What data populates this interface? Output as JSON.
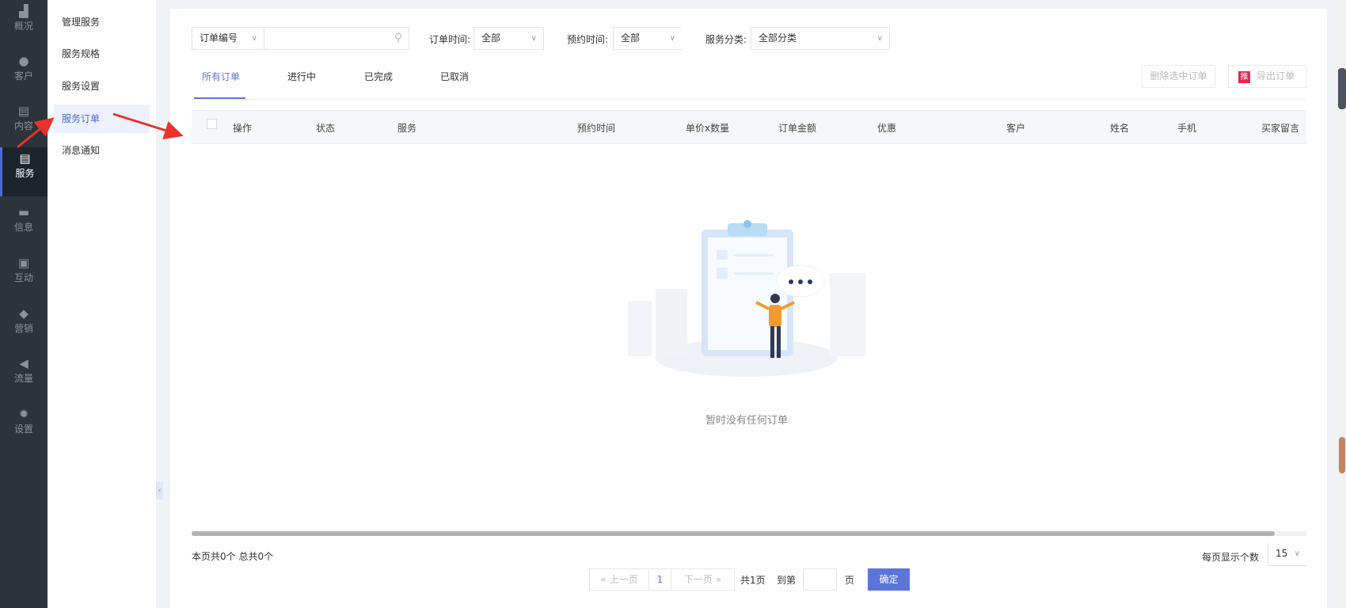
{
  "sidebar": {
    "items": [
      {
        "label": "概况",
        "icon": "chart-icon"
      },
      {
        "label": "客户",
        "icon": "users-icon"
      },
      {
        "label": "内容",
        "icon": "document-icon"
      },
      {
        "label": "服务",
        "icon": "service-icon",
        "active": true
      },
      {
        "label": "信息",
        "icon": "message-icon"
      },
      {
        "label": "互动",
        "icon": "gamepad-icon"
      },
      {
        "label": "营销",
        "icon": "tag-icon"
      },
      {
        "label": "流量",
        "icon": "megaphone-icon"
      },
      {
        "label": "设置",
        "icon": "gear-icon"
      }
    ]
  },
  "submenu": {
    "items": [
      {
        "label": "管理服务"
      },
      {
        "label": "服务规格"
      },
      {
        "label": "服务设置"
      },
      {
        "label": "服务订单",
        "active": true
      },
      {
        "label": "消息通知"
      }
    ]
  },
  "filters": {
    "search_type": "订单编号",
    "search_value": "",
    "order_time_label": "订单时间:",
    "order_time_value": "全部",
    "appoint_time_label": "预约时间:",
    "appoint_time_value": "全部",
    "category_label": "服务分类:",
    "category_value": "全部分类"
  },
  "tabs": [
    {
      "label": "所有订单",
      "active": true
    },
    {
      "label": "进行中"
    },
    {
      "label": "已完成"
    },
    {
      "label": "已取消"
    }
  ],
  "actions": {
    "delete": "删除选中订单",
    "export_badge": "推",
    "export": "导出订单"
  },
  "table": {
    "columns": [
      "操作",
      "状态",
      "服务",
      "预约时间",
      "单价x数量",
      "订单金额",
      "优惠",
      "客户",
      "姓名",
      "手机",
      "买家留言"
    ],
    "rows": []
  },
  "empty": {
    "text": "暂时没有任何订单"
  },
  "footer": {
    "summary": "本页共0个  总共0个",
    "per_page_label": "每页显示个数",
    "per_page": "15"
  },
  "pagination": {
    "prev": "« 上一页",
    "current": "1",
    "next": "下一页 »",
    "total": "共1页",
    "goto": "到第",
    "page": "页",
    "confirm": "确定",
    "goto_value": ""
  },
  "colors": {
    "accent": "#5b75d9",
    "sidebar": "#2b333b",
    "annotation": "#e8322b"
  }
}
